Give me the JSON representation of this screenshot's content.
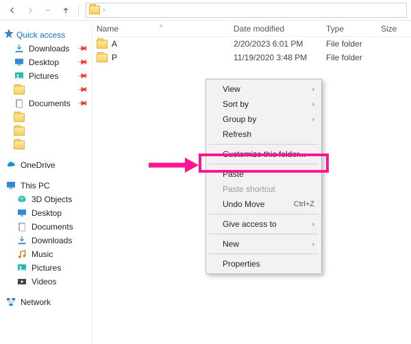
{
  "toolbar": {
    "back": "Back",
    "forward": "Forward",
    "up": "Up"
  },
  "columns": {
    "name": "Name",
    "date": "Date modified",
    "type": "Type",
    "size": "Size"
  },
  "rows": [
    {
      "name": "A",
      "date": "2/20/2023 6:01 PM",
      "type": "File folder"
    },
    {
      "name": "P",
      "date": "11/19/2020 3:48 PM",
      "type": "File folder"
    }
  ],
  "sidebar": {
    "quick_access": "Quick access",
    "quick_items": [
      {
        "label": "Downloads",
        "icon": "download",
        "pinned": true
      },
      {
        "label": "Desktop",
        "icon": "desktop",
        "pinned": true
      },
      {
        "label": "Pictures",
        "icon": "pictures",
        "pinned": true
      },
      {
        "label": "",
        "icon": "folder",
        "pinned": true
      },
      {
        "label": "Documents",
        "icon": "documents",
        "pinned": true
      },
      {
        "label": "",
        "icon": "folder",
        "pinned": false
      },
      {
        "label": "",
        "icon": "folder",
        "pinned": false
      },
      {
        "label": "",
        "icon": "folder",
        "pinned": false
      }
    ],
    "onedrive": "OneDrive",
    "this_pc": "This PC",
    "pc_items": [
      {
        "label": "3D Objects",
        "icon": "3d"
      },
      {
        "label": "Desktop",
        "icon": "desktop"
      },
      {
        "label": "Documents",
        "icon": "documents"
      },
      {
        "label": "Downloads",
        "icon": "download"
      },
      {
        "label": "Music",
        "icon": "music"
      },
      {
        "label": "Pictures",
        "icon": "pictures"
      },
      {
        "label": "Videos",
        "icon": "videos"
      }
    ],
    "network": "Network"
  },
  "context_menu": {
    "view": "View",
    "sort_by": "Sort by",
    "group_by": "Group by",
    "refresh": "Refresh",
    "customize": "Customize this folder...",
    "paste": "Paste",
    "paste_shortcut": "Paste shortcut",
    "undo_move": "Undo Move",
    "undo_shortcut": "Ctrl+Z",
    "give_access": "Give access to",
    "new": "New",
    "properties": "Properties"
  }
}
